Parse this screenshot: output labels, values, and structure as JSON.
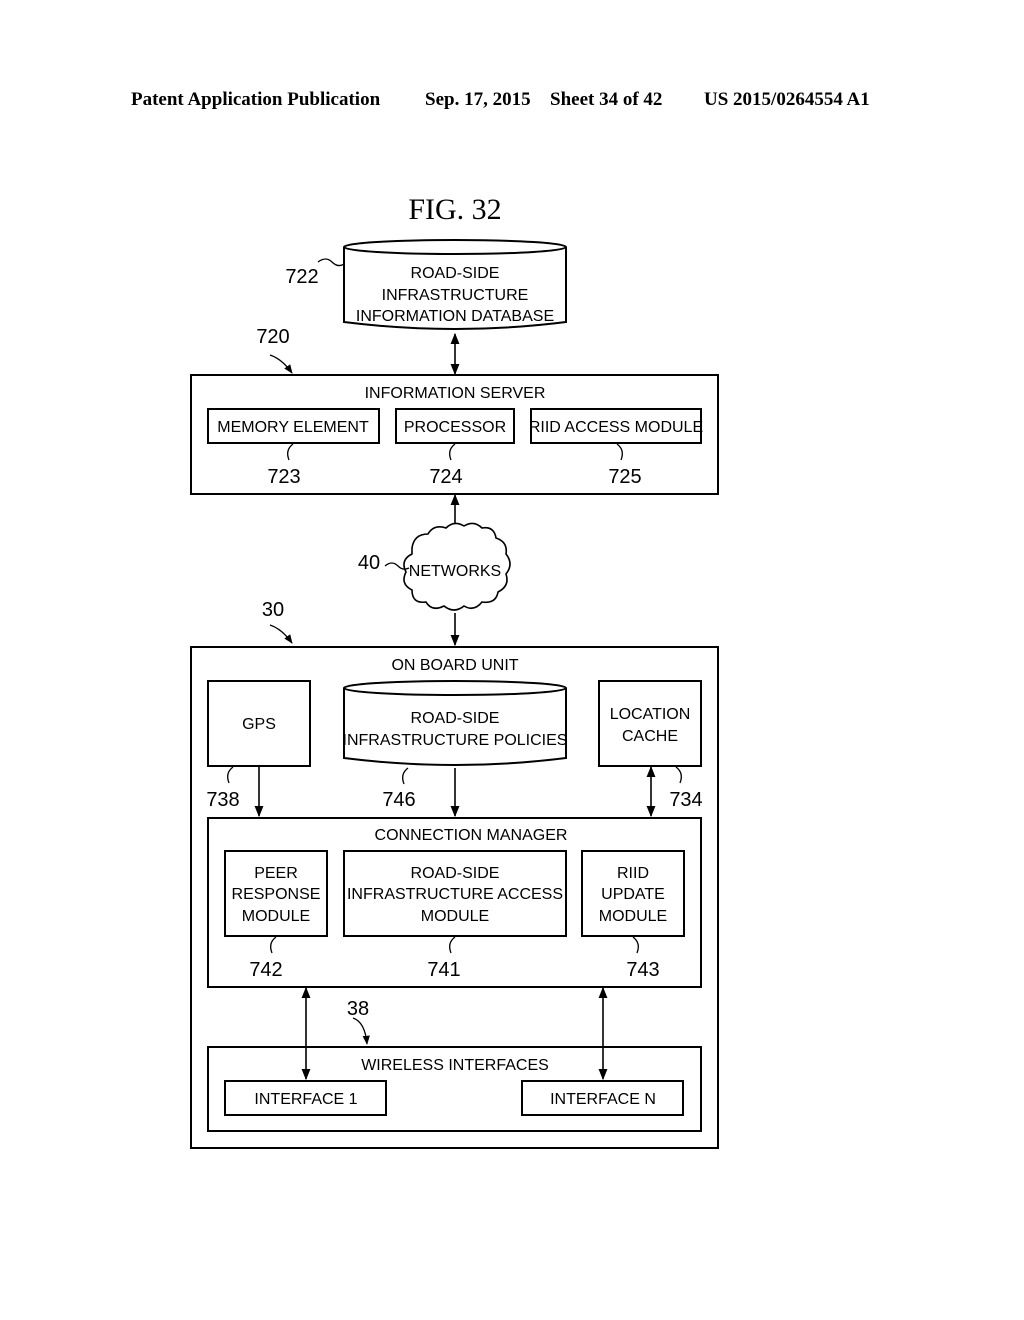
{
  "header": {
    "publication": "Patent Application Publication",
    "date": "Sep. 17, 2015",
    "sheet": "Sheet 34 of 42",
    "number": "US 2015/0264554 A1"
  },
  "figure": {
    "title": "FIG. 32",
    "database": {
      "ref": "722",
      "lines": [
        "ROAD-SIDE",
        "INFRASTRUCTURE",
        "INFORMATION DATABASE"
      ]
    },
    "information_server": {
      "ref": "720",
      "title": "INFORMATION SERVER",
      "components": [
        {
          "label": "MEMORY ELEMENT",
          "ref": "723"
        },
        {
          "label": "PROCESSOR",
          "ref": "724"
        },
        {
          "label": "RIID ACCESS MODULE",
          "ref": "725"
        }
      ]
    },
    "networks": {
      "ref": "40",
      "label": "NETWORKS"
    },
    "on_board_unit": {
      "ref": "30",
      "title": "ON BOARD UNIT",
      "gps": {
        "label": "GPS",
        "ref": "738"
      },
      "policies": {
        "lines": [
          "ROAD-SIDE",
          "INFRASTRUCTURE POLICIES"
        ],
        "ref": "746"
      },
      "location_cache": {
        "lines": [
          "LOCATION",
          "CACHE"
        ],
        "ref": "734"
      },
      "connection_manager": {
        "title": "CONNECTION MANAGER",
        "modules": [
          {
            "lines": [
              "PEER",
              "RESPONSE",
              "MODULE"
            ],
            "ref": "742"
          },
          {
            "lines": [
              "ROAD-SIDE",
              "INFRASTRUCTURE ACCESS",
              "MODULE"
            ],
            "ref": "741"
          },
          {
            "lines": [
              "RIID",
              "UPDATE",
              "MODULE"
            ],
            "ref": "743"
          }
        ]
      },
      "wireless_interfaces": {
        "ref": "38",
        "title": "WIRELESS INTERFACES",
        "interfaces": [
          "INTERFACE 1",
          "INTERFACE N"
        ]
      }
    }
  }
}
